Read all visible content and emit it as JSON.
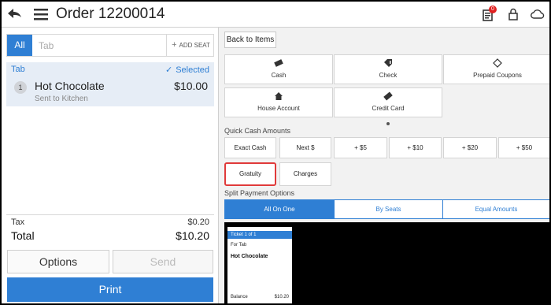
{
  "header": {
    "title": "Order 12200014",
    "notification_count": "0"
  },
  "left_panel": {
    "seat_tabs": {
      "all_label": "All",
      "tab_placeholder": "Tab",
      "add_seat_label": "ADD SEAT"
    },
    "tab_group": {
      "label": "Tab",
      "selected_label": "Selected"
    },
    "items": [
      {
        "seat": "1",
        "name": "Hot Chocolate",
        "price": "$10.00",
        "status": "Sent to Kitchen"
      }
    ],
    "totals": {
      "tax_label": "Tax",
      "tax_value": "$0.20",
      "total_label": "Total",
      "total_value": "$10.20"
    },
    "buttons": {
      "options": "Options",
      "send": "Send",
      "print": "Print"
    }
  },
  "right_panel": {
    "back_button": "Back to Items",
    "payment_methods": [
      {
        "label": "Cash",
        "icon": "cash-icon"
      },
      {
        "label": "Check",
        "icon": "check-icon"
      },
      {
        "label": "Prepaid Coupons",
        "icon": "coupon-icon"
      },
      {
        "label": "House Account",
        "icon": "house-icon"
      },
      {
        "label": "Credit Card",
        "icon": "credit-card-icon"
      }
    ],
    "quick_cash": {
      "label": "Quick Cash Amounts",
      "buttons": [
        "Exact Cash",
        "Next $",
        "+ $5",
        "+ $10",
        "+ $20",
        "+ $50"
      ]
    },
    "extras": {
      "gratuity": "Gratuity",
      "charges": "Charges"
    },
    "split": {
      "label": "Split Payment Options",
      "options": [
        "All On One",
        "By Seats",
        "Equal Amounts"
      ],
      "active": "All On One"
    },
    "ticket": {
      "header": "Ticket 1 of 1",
      "for_label": "For Tab",
      "item": "Hot Chocolate",
      "balance_label": "Balance",
      "balance_value": "$10.20"
    }
  },
  "colors": {
    "accent": "#2f7fd4",
    "highlight": "#e03a3a",
    "badge": "#e02020"
  }
}
